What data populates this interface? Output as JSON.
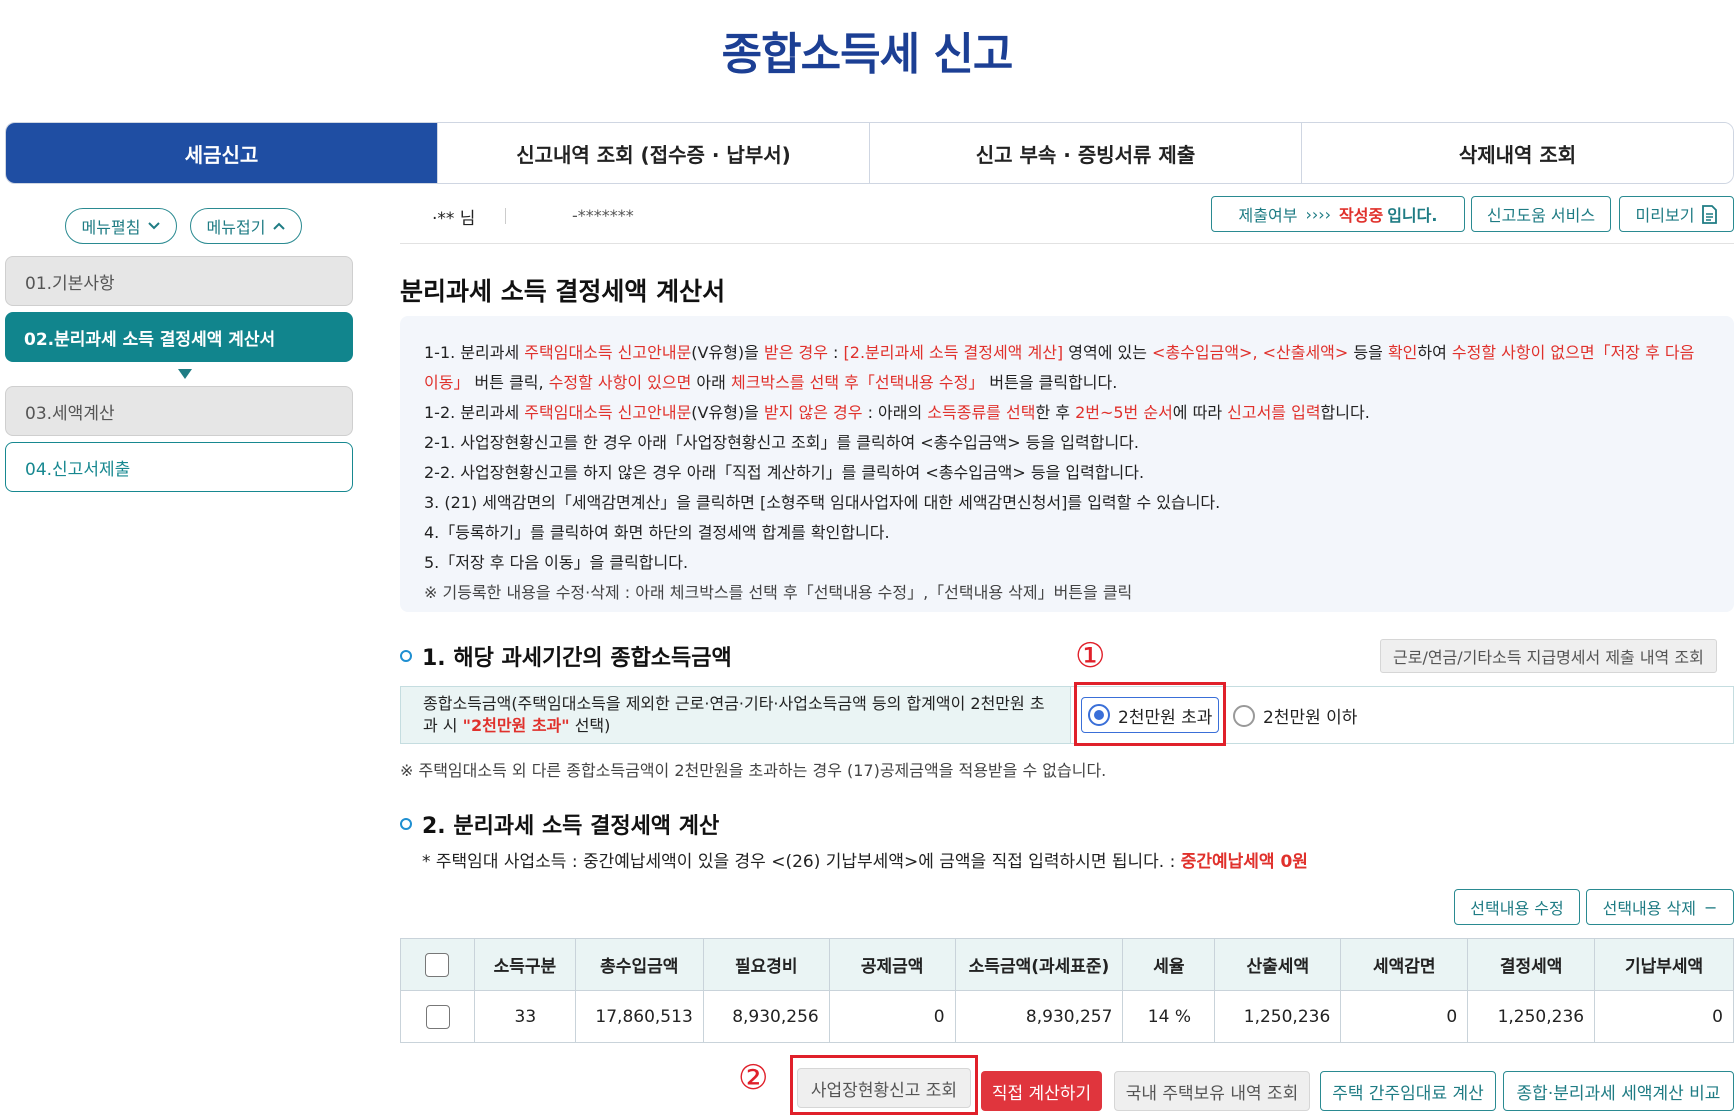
{
  "page": {
    "title": "종합소득세 신고"
  },
  "tabs": [
    "세금신고",
    "신고내역 조회 (접수증 · 납부서)",
    "신고 부속 · 증빙서류 제출",
    "삭제내역 조회"
  ],
  "sidebar": {
    "expand_label": "메뉴펼침",
    "collapse_label": "메뉴접기",
    "items": [
      {
        "label": "01.기본사항",
        "state": "done"
      },
      {
        "label": "02.분리과세 소득 결정세액 계산서",
        "state": "active"
      },
      {
        "label": "03.세액계산",
        "state": "done"
      },
      {
        "label": "04.신고서제출",
        "state": "todo"
      }
    ]
  },
  "userbar": {
    "name": "·** 님",
    "id_masked": "-*******",
    "status_prefix": "제출여부",
    "status_arrows": "››››",
    "status_value": "작성중",
    "status_suffix": "입니다.",
    "help_label": "신고도움 서비스",
    "preview_label": "미리보기"
  },
  "form": {
    "title": "분리과세 소득 결정세액 계산서",
    "guide": {
      "l1_a": "1-1. 분리과세 ",
      "l1_b": "주택임대소득 신고안내문",
      "l1_c": "(V유형)을 ",
      "l1_d": "받은 경우",
      "l1_e": " : ",
      "l1_f": "[2.분리과세 소득 결정세액 계산]",
      "l1_g": " 영역에 있는 ",
      "l1_h": "<총수입금액>, <산출세액>",
      "l1_i": " 등을 ",
      "l1_j": "확인",
      "l1_k": "하여 ",
      "l1_l": "수정할 사항이 없으면「저장 후 다음 이동」",
      "l1_m": " 버튼 클릭, ",
      "l1_n": "수정할 사항이 있으면",
      "l1_o": " 아래 ",
      "l1_p": "체크박스를 선택 후「선택내용 수정」",
      "l1_q": " 버튼을 클릭합니다.",
      "l2_a": "1-2. 분리과세 ",
      "l2_b": "주택임대소득 신고안내문",
      "l2_c": "(V유형)을 ",
      "l2_d": "받지 않은 경우",
      "l2_e": " : 아래의 ",
      "l2_f": "소득종류를 선택",
      "l2_g": "한 후 ",
      "l2_h": "2번~5번 순서",
      "l2_i": "에 따라 ",
      "l2_j": "신고서를 입력",
      "l2_k": "합니다.",
      "l3": "2-1. 사업장현황신고를 한 경우 아래「사업장현황신고 조회」를 클릭하여 <총수입금액> 등을 입력합니다.",
      "l4": "2-2. 사업장현황신고를 하지 않은 경우 아래「직접 계산하기」를 클릭하여 <총수입금액> 등을 입력합니다.",
      "l5": "3. (21) 세액감면의「세액감면계산」을 클릭하면 [소형주택 임대사업자에 대한 세액감면신청서]를 입력할 수 있습니다.",
      "l6": "4.「등록하기」를 클릭하여 화면 하단의 결정세액 합계를 확인합니다.",
      "l7": "5.「저장 후 다음 이동」을 클릭합니다.",
      "l8": "※ 기등록한 내용을 수정·삭제 : 아래 체크박스를 선택 후「선택내용 수정」,「선택내용 삭제」버튼을 클릭"
    }
  },
  "section1": {
    "title": "1. 해당 과세기간의 종합소득금액",
    "lookup_label": "근로/연금/기타소득 지급명세서 제출 내역 조회",
    "label_a": "종합소득금액(주택임대소득을 제외한 근로·연금·기타·사업소득금액 등의 합계액이 2천만원 초과 시 ",
    "label_b": "\"2천만원 초과\"",
    "label_c": " 선택)",
    "option_over": "2천만원 초과",
    "option_under": "2천만원 이하",
    "selected": "2천만원 초과",
    "note": "※ 주택임대소득 외 다른 종합소득금액이 2천만원을 초과하는 경우 (17)공제금액을 적용받을 수 없습니다.",
    "marker": "①"
  },
  "section2": {
    "title": "2. 분리과세 소득 결정세액 계산",
    "note_a": "* 주택임대 사업소득 : 중간예납세액이 있을 경우 <(26) 기납부세액>에 금액을 직접 입력하시면 됩니다. : ",
    "note_b": "중간예납세액 0원",
    "edit_label": "선택내용 수정",
    "delete_label": "선택내용 삭제",
    "delete_icon": "−"
  },
  "table": {
    "headers": [
      "소득구분",
      "총수입금액",
      "필요경비",
      "공제금액",
      "소득금액(과세표준)",
      "세율",
      "산출세액",
      "세액감면",
      "결정세액",
      "기납부세액"
    ],
    "rows": [
      [
        "33",
        "17,860,513",
        "8,930,256",
        "0",
        "8,930,257",
        "14 %",
        "1,250,236",
        "0",
        "1,250,236",
        "0"
      ]
    ]
  },
  "bottom": {
    "marker": "②",
    "lookup_label": "사업장현황신고 조회",
    "direct_label": "직접 계산하기",
    "domestic_label": "국내 주택보유 내역 조회",
    "rent_label": "주택 간주임대료 계산",
    "compare_label": "종합·분리과세 세액계산 비교"
  },
  "colors": {
    "brand": "#1f4ea3",
    "teal": "#11858d",
    "red": "#e0312c"
  }
}
